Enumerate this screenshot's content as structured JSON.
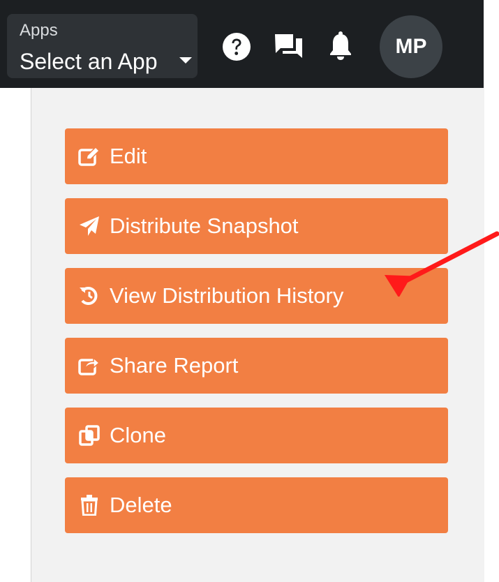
{
  "topbar": {
    "app_selector": {
      "label": "Apps",
      "value": "Select an App"
    },
    "icons": [
      "help-icon",
      "messages-icon",
      "notifications-icon"
    ],
    "avatar_initials": "MP"
  },
  "menu": {
    "items": [
      {
        "label": "Edit",
        "icon": "edit-icon"
      },
      {
        "label": "Distribute Snapshot",
        "icon": "paper-plane-icon"
      },
      {
        "label": "View Distribution History",
        "icon": "history-icon"
      },
      {
        "label": "Share Report",
        "icon": "share-icon"
      },
      {
        "label": "Clone",
        "icon": "clone-icon"
      },
      {
        "label": "Delete",
        "icon": "trash-icon"
      }
    ]
  },
  "colors": {
    "topbar": "#1c1f22",
    "button": "#f27f43",
    "panel": "#f2f2f2",
    "annotation_arrow": "#ff1a1a"
  }
}
